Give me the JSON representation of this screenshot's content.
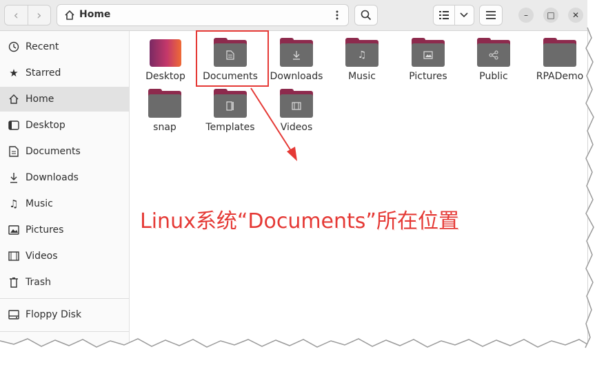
{
  "header": {
    "back_label": "‹",
    "forward_label": "›",
    "location": "Home",
    "path_menu_icon": "vertical-dots-icon",
    "search_icon": "search-icon",
    "view_icon": "list-view-icon",
    "view_dropdown_icon": "chevron-down-icon",
    "menu_icon": "hamburger-menu-icon",
    "minimize_label": "–",
    "maximize_label": "□",
    "close_label": "✕"
  },
  "sidebar": {
    "items": [
      {
        "label": "Recent",
        "icon": "clock-icon"
      },
      {
        "label": "Starred",
        "icon": "star-icon"
      },
      {
        "label": "Home",
        "icon": "home-icon",
        "active": true
      },
      {
        "label": "Desktop",
        "icon": "desktop-icon"
      },
      {
        "label": "Documents",
        "icon": "document-icon"
      },
      {
        "label": "Downloads",
        "icon": "download-icon"
      },
      {
        "label": "Music",
        "icon": "music-icon"
      },
      {
        "label": "Pictures",
        "icon": "picture-icon"
      },
      {
        "label": "Videos",
        "icon": "video-icon"
      },
      {
        "label": "Trash",
        "icon": "trash-icon"
      },
      {
        "label": "Floppy Disk",
        "icon": "floppy-icon"
      }
    ]
  },
  "files": [
    {
      "label": "Desktop",
      "icon": "desktop-gradient"
    },
    {
      "label": "Documents",
      "icon": "document-icon"
    },
    {
      "label": "Downloads",
      "icon": "download-icon"
    },
    {
      "label": "Music",
      "icon": "music-icon"
    },
    {
      "label": "Pictures",
      "icon": "picture-icon"
    },
    {
      "label": "Public",
      "icon": "share-icon"
    },
    {
      "label": "RPADemo",
      "icon": "none"
    },
    {
      "label": "snap",
      "icon": "none"
    },
    {
      "label": "Templates",
      "icon": "template-icon"
    },
    {
      "label": "Videos",
      "icon": "video-icon"
    }
  ],
  "annotation": {
    "text": "Linux系统“Documents”所在位置",
    "color": "#e53935"
  },
  "colors": {
    "folder_tab": "#8d2a4d",
    "folder_body": "#6b6b6b",
    "header_bg": "#ebebeb",
    "sidebar_active": "#e2e2e2"
  }
}
